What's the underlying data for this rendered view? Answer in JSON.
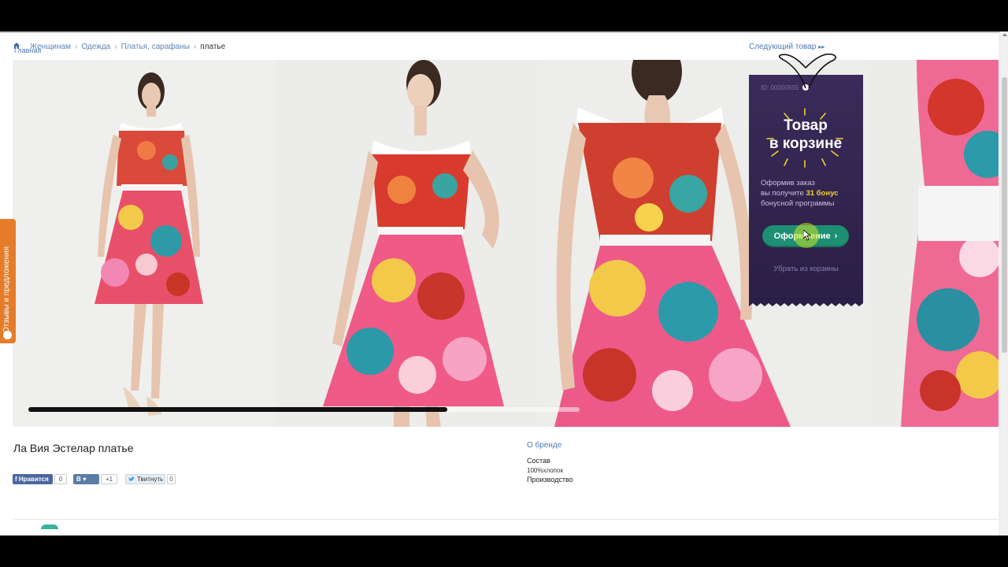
{
  "breadcrumb": {
    "home_label": "Главная",
    "items": [
      "Женщинам",
      "Одежда",
      "Платья, сарафаны"
    ],
    "current": "платье"
  },
  "next_item": {
    "label": "Следующий товар",
    "arrows": "▸▸"
  },
  "gallery": {
    "slider_progress": 0.76
  },
  "cart_popup": {
    "id_label": "ID: 00000555",
    "title_line1": "Товар",
    "title_line2": "в корзине",
    "text_line1": "Оформив заказ",
    "text_line2_prefix": "вы получите",
    "bonus": "31 бонус",
    "text_line3": "бонусной программы",
    "checkout_label": "Оформление",
    "checkout_chevron": "›",
    "remove_label": "Убрать из корзины",
    "bg_color": "#3b2a59",
    "button_color": "#1d8f73",
    "bonus_color": "#f3d130"
  },
  "feedback_tab": {
    "label": "Отзывы и предложения",
    "color": "#e47c2a"
  },
  "product": {
    "title": "Ла Вия Эстелар платье",
    "brand_link": "О бренде",
    "composition_label": "Состав",
    "composition_value": "100%хлопок",
    "production_label": "Производство"
  },
  "social": {
    "fb_label": "Нравится",
    "fb_count": "0",
    "vk_label": "В",
    "vk_count": "+1",
    "tw_label": "Твитнуть",
    "tw_count": "0"
  }
}
